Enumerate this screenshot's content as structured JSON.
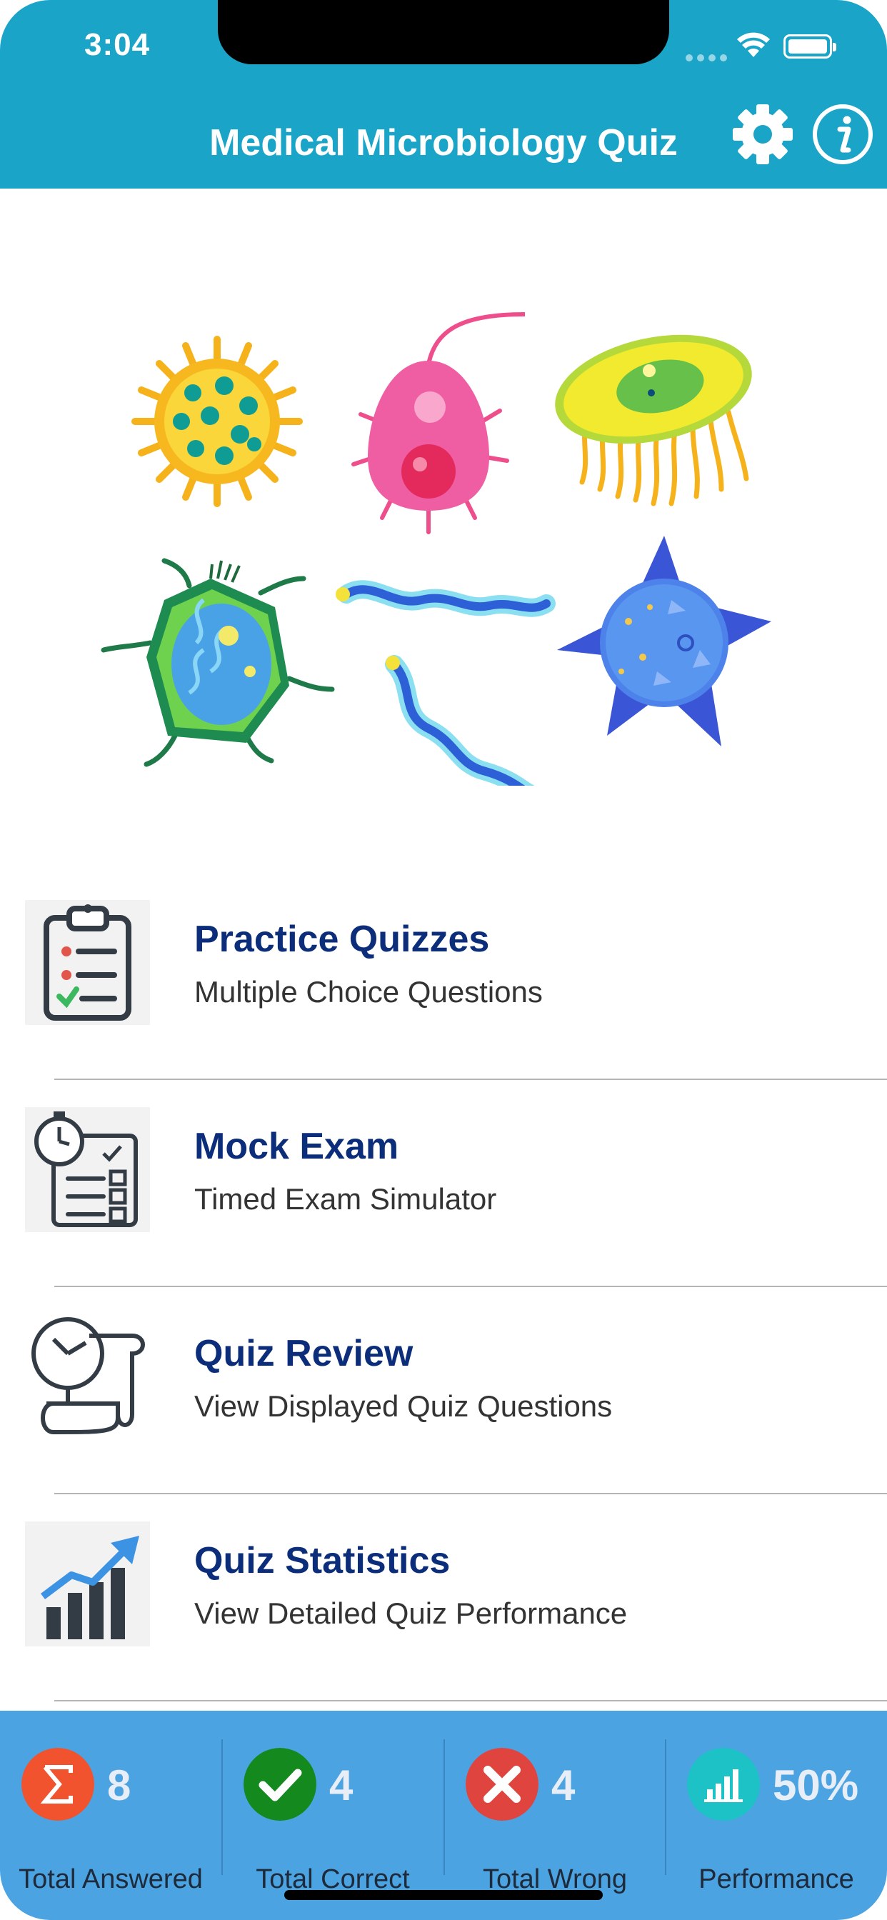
{
  "status_bar": {
    "time": "3:04"
  },
  "nav": {
    "title": "Medical Microbiology Quiz",
    "settings_icon": "gear-icon",
    "info_icon": "info-icon"
  },
  "hero": {
    "image": "microbes-illustration"
  },
  "menu": [
    {
      "title": "Practice Quizzes",
      "subtitle": "Multiple Choice Questions",
      "icon": "clipboard-checklist-icon"
    },
    {
      "title": "Mock Exam",
      "subtitle": "Timed Exam Simulator",
      "icon": "stopwatch-checklist-icon"
    },
    {
      "title": "Quiz Review",
      "subtitle": "View Displayed Quiz Questions",
      "icon": "clock-scroll-icon"
    },
    {
      "title": "Quiz Statistics",
      "subtitle": "View Detailed Quiz Performance",
      "icon": "bar-chart-up-icon"
    }
  ],
  "stats": [
    {
      "label": "Total Answered",
      "value": "8",
      "icon": "sigma-icon",
      "color": "#f0532d"
    },
    {
      "label": "Total Correct",
      "value": "4",
      "icon": "checkmark-icon",
      "color": "#14891e"
    },
    {
      "label": "Total Wrong",
      "value": "4",
      "icon": "x-icon",
      "color": "#e0443f"
    },
    {
      "label": "Performance",
      "value": "50%",
      "icon": "bar-chart-icon",
      "color": "#1cc2c6"
    }
  ],
  "colors": {
    "header": "#19a4c8",
    "footer": "#4ba4e1",
    "menu_title": "#0c2e7a"
  }
}
